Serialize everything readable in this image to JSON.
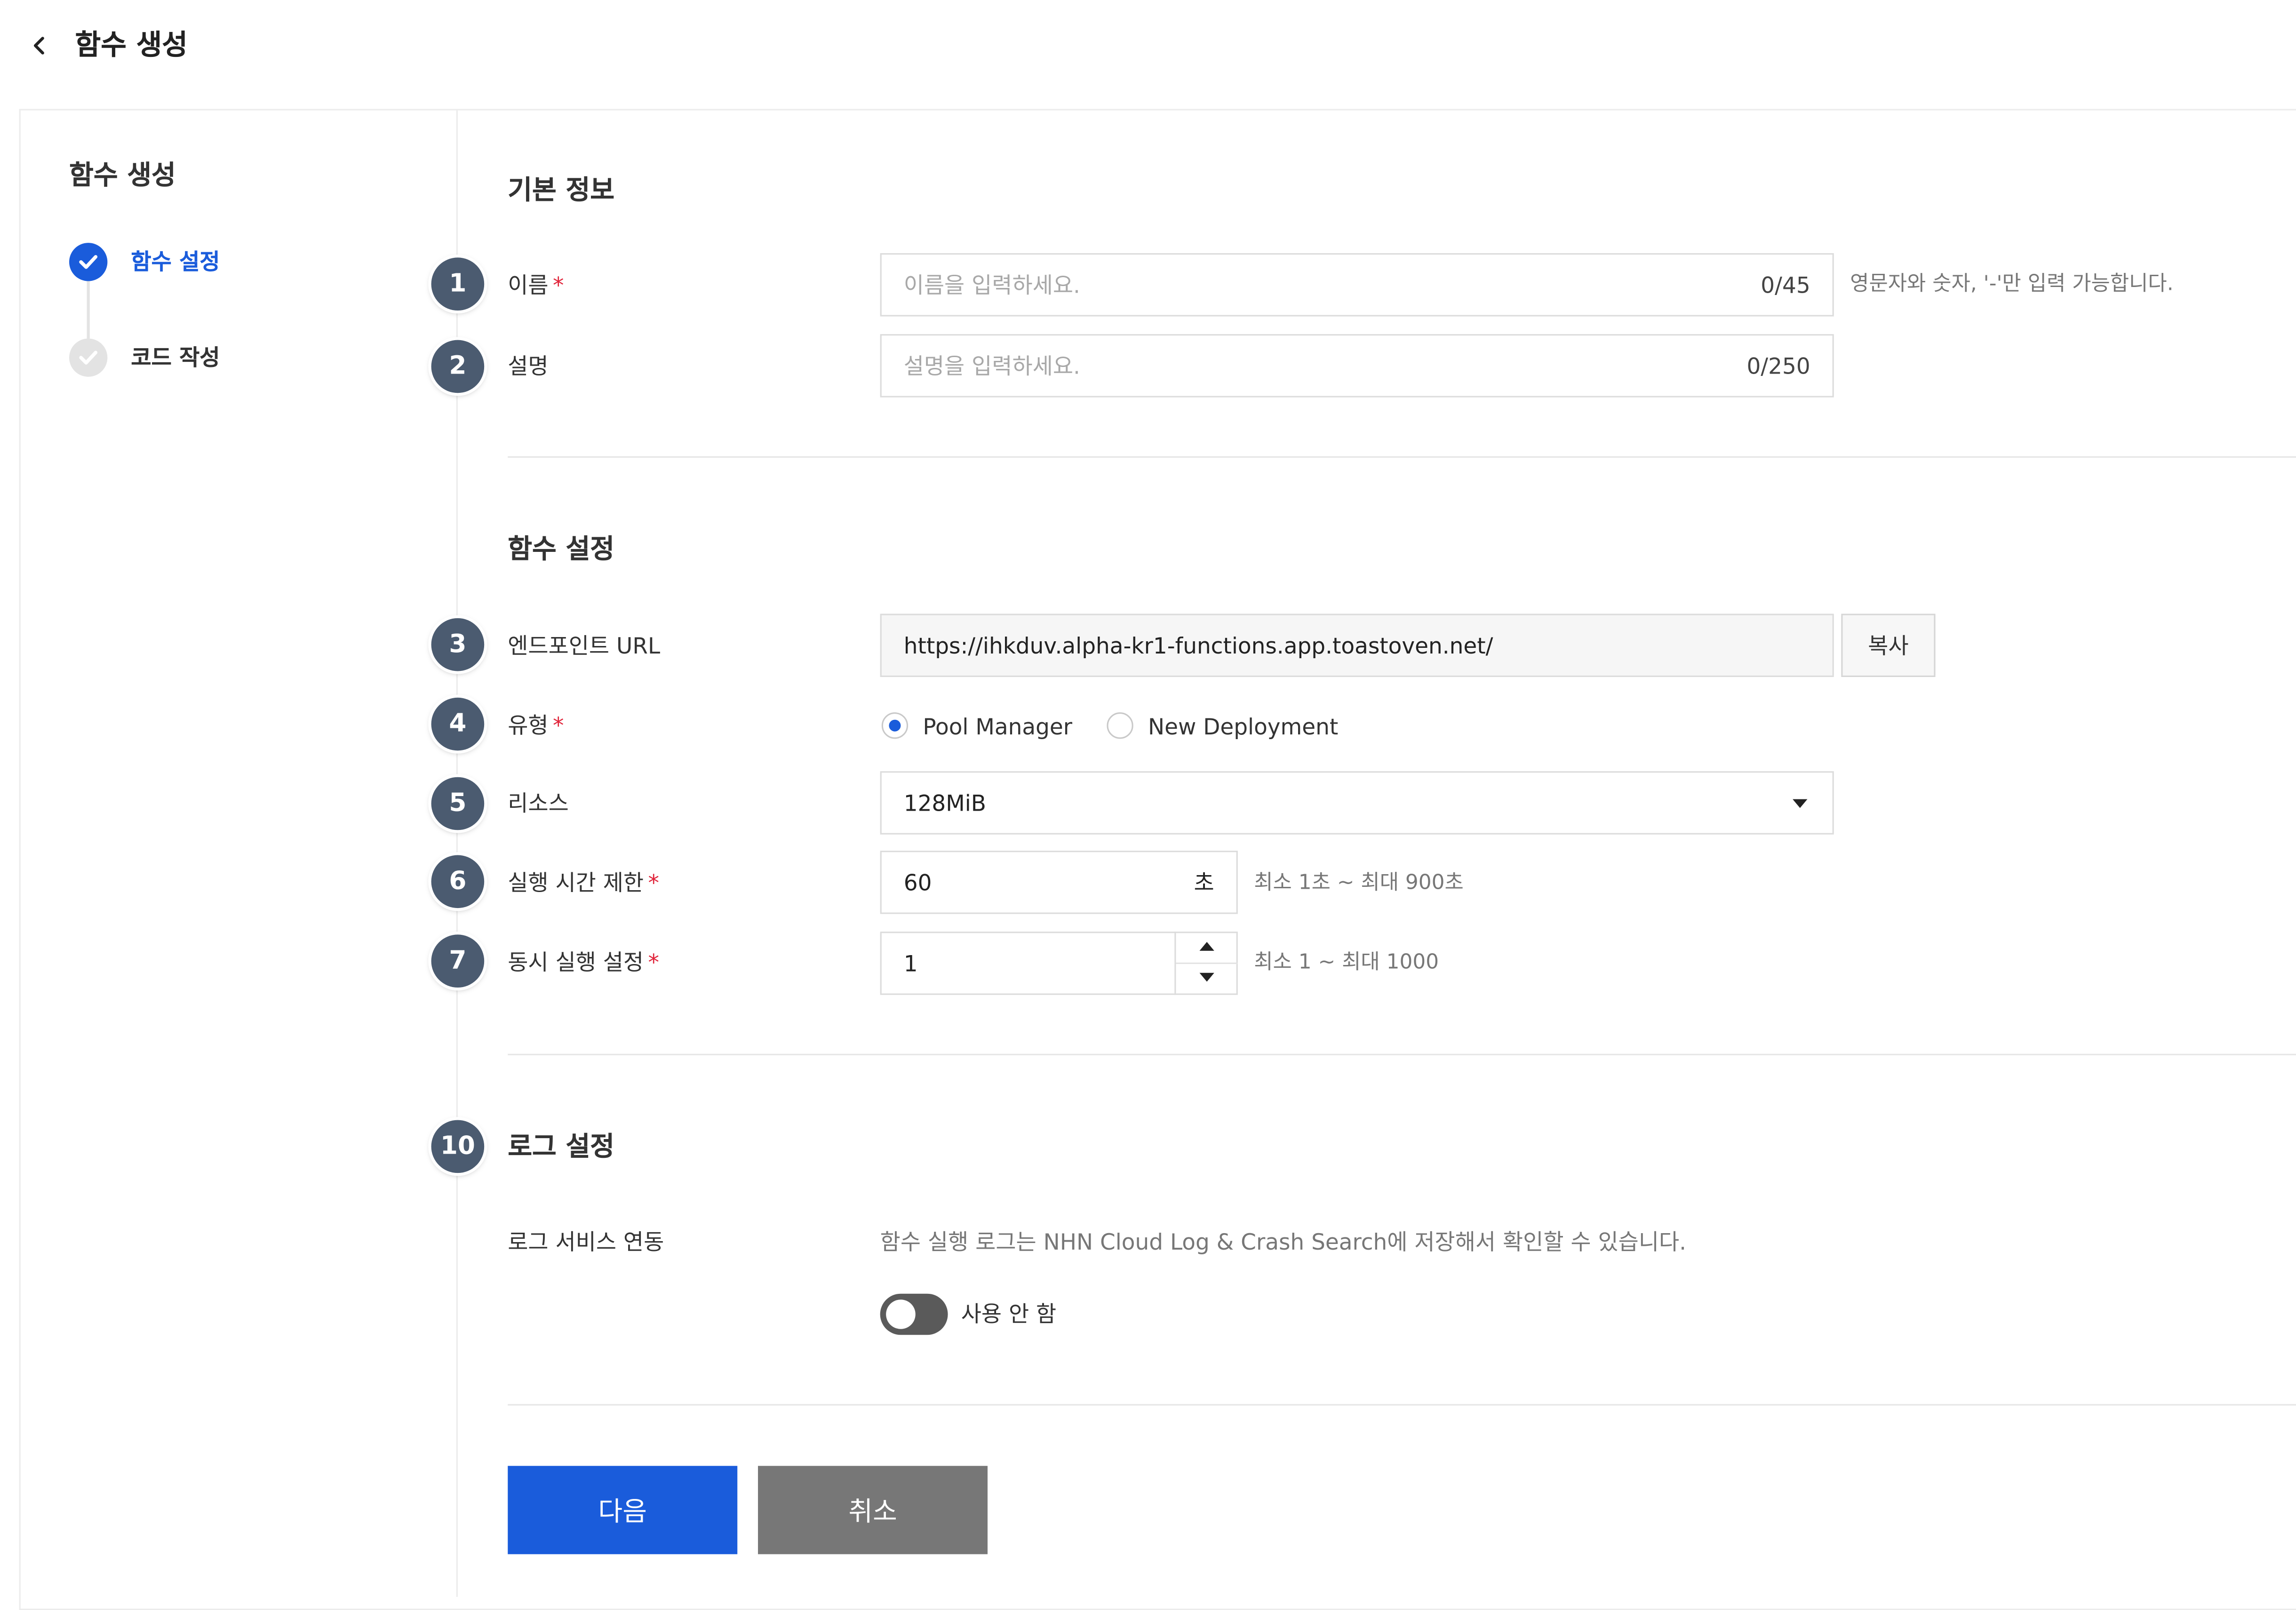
{
  "header": {
    "title": "함수 생성"
  },
  "sidebar": {
    "title": "함수 생성",
    "steps": [
      {
        "label": "함수 설정",
        "state": "active"
      },
      {
        "label": "코드 작성",
        "state": "pending"
      }
    ]
  },
  "sections": {
    "basic": {
      "title": "기본 정보"
    },
    "function": {
      "title": "함수 설정"
    },
    "log": {
      "title": "로그 설정"
    }
  },
  "callouts": [
    "1",
    "2",
    "3",
    "4",
    "5",
    "6",
    "7",
    "10"
  ],
  "fields": {
    "name": {
      "label": "이름",
      "required_mark": "*",
      "placeholder": "이름을 입력하세요.",
      "counter": "0/45",
      "hint": "영문자와 숫자, '-'만 입력 가능합니다."
    },
    "description": {
      "label": "설명",
      "placeholder": "설명을 입력하세요.",
      "counter": "0/250"
    },
    "endpoint": {
      "label": "엔드포인트 URL",
      "value": "https://ihkduv.alpha-kr1-functions.app.toastoven.net/",
      "copy_label": "복사"
    },
    "type": {
      "label": "유형",
      "required_mark": "*",
      "options": [
        {
          "label": "Pool Manager",
          "selected": true
        },
        {
          "label": "New Deployment",
          "selected": false
        }
      ]
    },
    "resource": {
      "label": "리소스",
      "value": "128MiB"
    },
    "timeout": {
      "label": "실행 시간 제한",
      "required_mark": "*",
      "value": "60",
      "unit": "초",
      "hint": "최소 1초 ~ 최대 900초"
    },
    "concurrency": {
      "label": "동시 실행 설정",
      "required_mark": "*",
      "value": "1",
      "hint": "최소 1 ~ 최대 1000"
    },
    "log_service": {
      "label": "로그 서비스 연동",
      "description": "함수 실행 로그는 NHN Cloud Log & Crash Search에 저장해서 확인할 수 있습니다.",
      "toggle_label": "사용 안 함",
      "enabled": false
    }
  },
  "buttons": {
    "next": "다음",
    "cancel": "취소"
  },
  "colors": {
    "primary": "#1a5cdb",
    "required": "#e0243a",
    "badge": "#4b5b70",
    "cancel": "#777777"
  }
}
